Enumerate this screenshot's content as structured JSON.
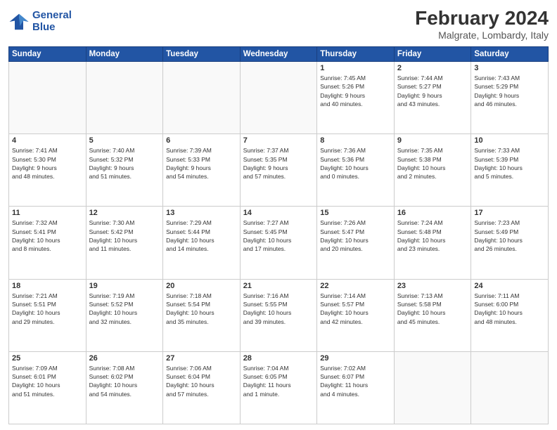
{
  "logo": {
    "line1": "General",
    "line2": "Blue"
  },
  "title": "February 2024",
  "subtitle": "Malgrate, Lombardy, Italy",
  "days_header": [
    "Sunday",
    "Monday",
    "Tuesday",
    "Wednesday",
    "Thursday",
    "Friday",
    "Saturday"
  ],
  "weeks": [
    [
      {
        "num": "",
        "info": "",
        "empty": true
      },
      {
        "num": "",
        "info": "",
        "empty": true
      },
      {
        "num": "",
        "info": "",
        "empty": true
      },
      {
        "num": "",
        "info": "",
        "empty": true
      },
      {
        "num": "1",
        "info": "Sunrise: 7:45 AM\nSunset: 5:26 PM\nDaylight: 9 hours\nand 40 minutes."
      },
      {
        "num": "2",
        "info": "Sunrise: 7:44 AM\nSunset: 5:27 PM\nDaylight: 9 hours\nand 43 minutes."
      },
      {
        "num": "3",
        "info": "Sunrise: 7:43 AM\nSunset: 5:29 PM\nDaylight: 9 hours\nand 46 minutes."
      }
    ],
    [
      {
        "num": "4",
        "info": "Sunrise: 7:41 AM\nSunset: 5:30 PM\nDaylight: 9 hours\nand 48 minutes."
      },
      {
        "num": "5",
        "info": "Sunrise: 7:40 AM\nSunset: 5:32 PM\nDaylight: 9 hours\nand 51 minutes."
      },
      {
        "num": "6",
        "info": "Sunrise: 7:39 AM\nSunset: 5:33 PM\nDaylight: 9 hours\nand 54 minutes."
      },
      {
        "num": "7",
        "info": "Sunrise: 7:37 AM\nSunset: 5:35 PM\nDaylight: 9 hours\nand 57 minutes."
      },
      {
        "num": "8",
        "info": "Sunrise: 7:36 AM\nSunset: 5:36 PM\nDaylight: 10 hours\nand 0 minutes."
      },
      {
        "num": "9",
        "info": "Sunrise: 7:35 AM\nSunset: 5:38 PM\nDaylight: 10 hours\nand 2 minutes."
      },
      {
        "num": "10",
        "info": "Sunrise: 7:33 AM\nSunset: 5:39 PM\nDaylight: 10 hours\nand 5 minutes."
      }
    ],
    [
      {
        "num": "11",
        "info": "Sunrise: 7:32 AM\nSunset: 5:41 PM\nDaylight: 10 hours\nand 8 minutes."
      },
      {
        "num": "12",
        "info": "Sunrise: 7:30 AM\nSunset: 5:42 PM\nDaylight: 10 hours\nand 11 minutes."
      },
      {
        "num": "13",
        "info": "Sunrise: 7:29 AM\nSunset: 5:44 PM\nDaylight: 10 hours\nand 14 minutes."
      },
      {
        "num": "14",
        "info": "Sunrise: 7:27 AM\nSunset: 5:45 PM\nDaylight: 10 hours\nand 17 minutes."
      },
      {
        "num": "15",
        "info": "Sunrise: 7:26 AM\nSunset: 5:47 PM\nDaylight: 10 hours\nand 20 minutes."
      },
      {
        "num": "16",
        "info": "Sunrise: 7:24 AM\nSunset: 5:48 PM\nDaylight: 10 hours\nand 23 minutes."
      },
      {
        "num": "17",
        "info": "Sunrise: 7:23 AM\nSunset: 5:49 PM\nDaylight: 10 hours\nand 26 minutes."
      }
    ],
    [
      {
        "num": "18",
        "info": "Sunrise: 7:21 AM\nSunset: 5:51 PM\nDaylight: 10 hours\nand 29 minutes."
      },
      {
        "num": "19",
        "info": "Sunrise: 7:19 AM\nSunset: 5:52 PM\nDaylight: 10 hours\nand 32 minutes."
      },
      {
        "num": "20",
        "info": "Sunrise: 7:18 AM\nSunset: 5:54 PM\nDaylight: 10 hours\nand 35 minutes."
      },
      {
        "num": "21",
        "info": "Sunrise: 7:16 AM\nSunset: 5:55 PM\nDaylight: 10 hours\nand 39 minutes."
      },
      {
        "num": "22",
        "info": "Sunrise: 7:14 AM\nSunset: 5:57 PM\nDaylight: 10 hours\nand 42 minutes."
      },
      {
        "num": "23",
        "info": "Sunrise: 7:13 AM\nSunset: 5:58 PM\nDaylight: 10 hours\nand 45 minutes."
      },
      {
        "num": "24",
        "info": "Sunrise: 7:11 AM\nSunset: 6:00 PM\nDaylight: 10 hours\nand 48 minutes."
      }
    ],
    [
      {
        "num": "25",
        "info": "Sunrise: 7:09 AM\nSunset: 6:01 PM\nDaylight: 10 hours\nand 51 minutes."
      },
      {
        "num": "26",
        "info": "Sunrise: 7:08 AM\nSunset: 6:02 PM\nDaylight: 10 hours\nand 54 minutes."
      },
      {
        "num": "27",
        "info": "Sunrise: 7:06 AM\nSunset: 6:04 PM\nDaylight: 10 hours\nand 57 minutes."
      },
      {
        "num": "28",
        "info": "Sunrise: 7:04 AM\nSunset: 6:05 PM\nDaylight: 11 hours\nand 1 minute."
      },
      {
        "num": "29",
        "info": "Sunrise: 7:02 AM\nSunset: 6:07 PM\nDaylight: 11 hours\nand 4 minutes."
      },
      {
        "num": "",
        "info": "",
        "empty": true
      },
      {
        "num": "",
        "info": "",
        "empty": true
      }
    ]
  ]
}
